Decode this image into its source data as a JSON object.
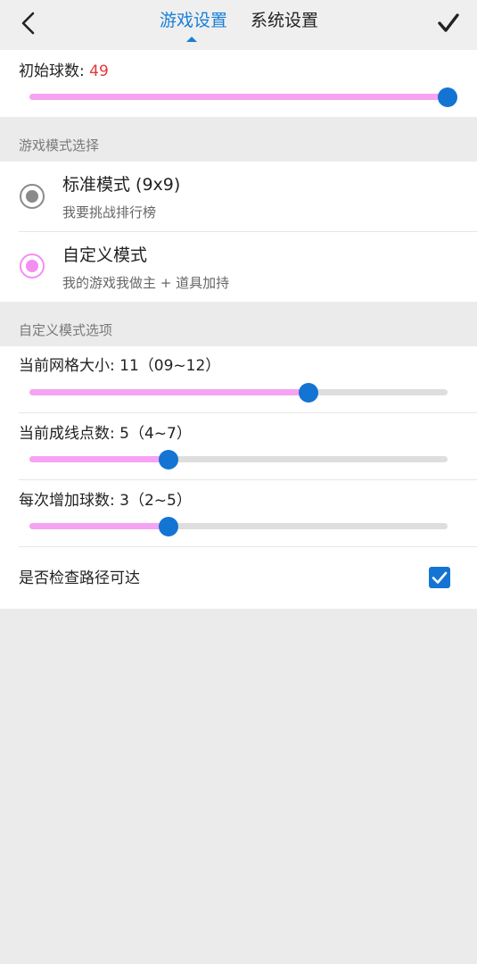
{
  "header": {
    "tabs": [
      {
        "label": "游戏设置",
        "active": true
      },
      {
        "label": "系统设置",
        "active": false
      }
    ],
    "accent_color": "#1a7fd6"
  },
  "initial_balls": {
    "label_prefix": "初始球数:",
    "value": "49",
    "slider_fraction": 1.0
  },
  "mode_section": {
    "title": "游戏模式选择",
    "modes": [
      {
        "title": "标准模式 (9x9)",
        "subtitle": "我要挑战排行榜",
        "selected": false
      },
      {
        "title": "自定义模式",
        "subtitle": "我的游戏我做主 + 道具加持",
        "selected": true
      }
    ]
  },
  "options_section": {
    "title": "自定义模式选项",
    "grid_size": {
      "label": "当前网格大小: 11（09~12）",
      "slider_fraction": 0.667
    },
    "line_points": {
      "label": "当前成线点数: 5（4~7）",
      "slider_fraction": 0.333
    },
    "balls_per_turn": {
      "label": "每次增加球数: 3（2~5）",
      "slider_fraction": 0.333
    },
    "check_path": {
      "label": "是否检查路径可达",
      "checked": true
    }
  },
  "colors": {
    "slider_fill": "#f7a3f3",
    "slider_thumb": "#1474d3",
    "radio_selected": "#f48ef0",
    "value_red": "#e53935"
  }
}
